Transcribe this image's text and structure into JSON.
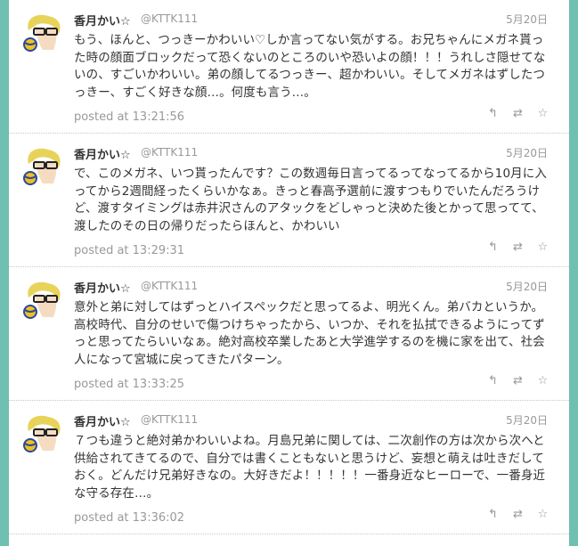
{
  "tweets": [
    {
      "name": "香月かい☆",
      "handle": "@KTTK111",
      "date": "5月20日",
      "text": "もう、ほんと、つっきーかわいい♡しか言ってない気がする。お兄ちゃんにメガネ貰った時の顔面ブロックだって恐くないのところのいや恐いよの顔！！！うれしさ隠せてないの、すごいかわいい。弟の顔してるつっきー、超かわいい。そしてメガネはずしたつっきー、すごく好きな顔…。何度も言う…。",
      "posted": "posted at 13:21:56"
    },
    {
      "name": "香月かい☆",
      "handle": "@KTTK111",
      "date": "5月20日",
      "text": "で、このメガネ、いつ貰ったんです？この数週毎日言ってるってなってるから10月に入ってから2週間経ったくらいかなぁ。きっと春高予選前に渡すつもりでいたんだろうけど、渡すタイミングは赤井沢さんのアタックをどしゃっと決めた後とかって思ってて、渡したのその日の帰りだったらほんと、かわいい",
      "posted": "posted at 13:29:31"
    },
    {
      "name": "香月かい☆",
      "handle": "@KTTK111",
      "date": "5月20日",
      "text": "意外と弟に対してはずっとハイスペックだと思ってるよ、明光くん。弟バカというか。高校時代、自分のせいで傷つけちゃったから、いつか、それを払拭できるようにってずっと思ってたらいいなぁ。絶対高校卒業したあと大学進学するのを機に家を出て、社会人になって宮城に戻ってきたパターン。",
      "posted": "posted at 13:33:25"
    },
    {
      "name": "香月かい☆",
      "handle": "@KTTK111",
      "date": "5月20日",
      "text": "７つも違うと絶対弟かわいいよね。月島兄弟に関しては、二次創作の方は次から次へと供給されてきてるので、自分では書くこともないと思うけど、妄想と萌えは吐きだしておく。どんだけ兄弟好きなの。大好きだよ！！！！！一番身近なヒーローで、一番身近な守る存在…。",
      "posted": "posted at 13:36:02"
    }
  ],
  "icons": {
    "reply": "reply-icon",
    "retweet": "retweet-icon",
    "favorite": "star-icon"
  }
}
